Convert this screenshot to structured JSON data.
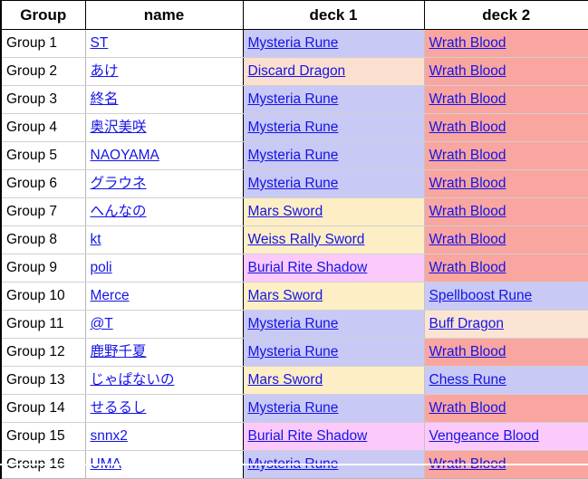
{
  "table": {
    "columns": [
      {
        "key": "group",
        "label": "Group"
      },
      {
        "key": "name",
        "label": "name"
      },
      {
        "key": "deck1",
        "label": "deck 1"
      },
      {
        "key": "deck2",
        "label": "deck 2"
      }
    ],
    "rows": [
      {
        "group": "Group 1",
        "name": "ST",
        "deck1": "Mysteria Rune",
        "deck2": "Wrath Blood"
      },
      {
        "group": "Group 2",
        "name": "あけ",
        "deck1": "Discard Dragon",
        "deck2": "Wrath Blood"
      },
      {
        "group": "Group 3",
        "name": "終名",
        "deck1": "Mysteria Rune",
        "deck2": "Wrath Blood"
      },
      {
        "group": "Group 4",
        "name": "奥沢美咲",
        "deck1": "Mysteria Rune",
        "deck2": "Wrath Blood"
      },
      {
        "group": "Group 5",
        "name": "NAOYAMA",
        "deck1": "Mysteria Rune",
        "deck2": "Wrath Blood"
      },
      {
        "group": "Group 6",
        "name": "グラウネ",
        "deck1": "Mysteria Rune",
        "deck2": "Wrath Blood"
      },
      {
        "group": "Group 7",
        "name": "へんなの",
        "deck1": "Mars Sword",
        "deck2": "Wrath Blood"
      },
      {
        "group": "Group 8",
        "name": "kt",
        "deck1": "Weiss Rally Sword",
        "deck2": "Wrath Blood"
      },
      {
        "group": "Group 9",
        "name": "poli",
        "deck1": "Burial Rite Shadow",
        "deck2": "Wrath Blood"
      },
      {
        "group": "Group 10",
        "name": "Merce",
        "deck1": "Mars Sword",
        "deck2": "Spellboost Rune"
      },
      {
        "group": "Group 11",
        "name": "@T",
        "deck1": "Mysteria Rune",
        "deck2": "Buff Dragon"
      },
      {
        "group": "Group 12",
        "name": "鹿野千夏",
        "deck1": "Mysteria Rune",
        "deck2": "Wrath Blood"
      },
      {
        "group": "Group 13",
        "name": "じゃぱないの",
        "deck1": "Mars Sword",
        "deck2": "Chess Rune"
      },
      {
        "group": "Group 14",
        "name": "せるるし",
        "deck1": "Mysteria Rune",
        "deck2": "Wrath Blood"
      },
      {
        "group": "Group 15",
        "name": "snnx2",
        "deck1": "Burial Rite Shadow",
        "deck2": "Vengeance Blood"
      },
      {
        "group": "Group 16",
        "name": "UMA",
        "deck1": "Mysteria Rune",
        "deck2": "Wrath Blood"
      }
    ]
  },
  "deck_colors": {
    "Mysteria Rune": "#c9c9f5",
    "Spellboost Rune": "#c9c9f5",
    "Chess Rune": "#c9c9f5",
    "Discard Dragon": "#fce0cf",
    "Buff Dragon": "#fce4d4",
    "Mars Sword": "#fdeec6",
    "Weiss Rally Sword": "#fdeec6",
    "Burial Rite Shadow": "#fcc9fb",
    "Vengeance Blood": "#fcc9fb",
    "Wrath Blood": "#f9a6a0"
  },
  "style": {
    "link_color": "#1414e6",
    "header_text_color": "#000000",
    "sheet_background": "#ffffff",
    "grid_line_color": "#d0d0d0",
    "outer_border_color": "#000000"
  }
}
